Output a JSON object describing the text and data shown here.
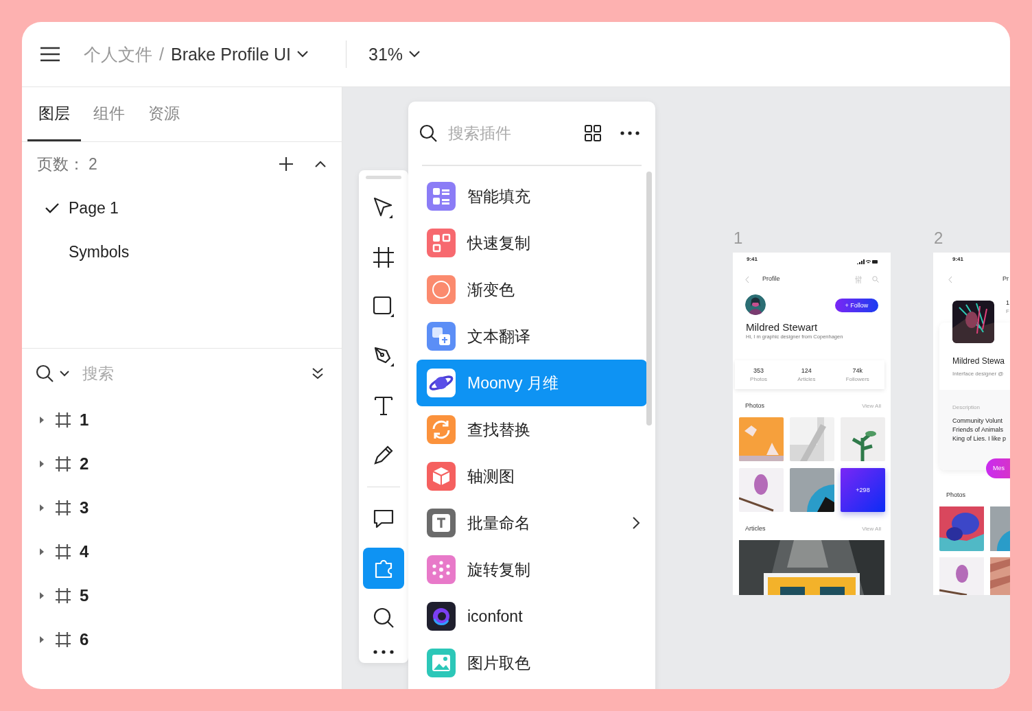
{
  "header": {
    "folder": "个人文件",
    "separator": "/",
    "file": "Brake Profile UI",
    "zoom": "31%"
  },
  "tabs": [
    {
      "label": "图层",
      "selected": true
    },
    {
      "label": "组件",
      "selected": false
    },
    {
      "label": "资源",
      "selected": false
    }
  ],
  "pages": {
    "label": "页数：",
    "count": "2",
    "items": [
      {
        "label": "Page 1",
        "selected": true
      },
      {
        "label": "Symbols",
        "selected": false
      }
    ]
  },
  "layer_search": {
    "placeholder": "搜索"
  },
  "layers": [
    {
      "label": "1",
      "expanded": false
    },
    {
      "label": "2",
      "expanded": false
    },
    {
      "label": "3",
      "expanded": false
    },
    {
      "label": "4",
      "expanded": false
    },
    {
      "label": "5",
      "expanded": false
    },
    {
      "label": "6",
      "expanded": false
    }
  ],
  "tools": [
    {
      "selected": false
    },
    {
      "selected": false
    },
    {
      "selected": false
    },
    {
      "selected": false
    },
    {
      "selected": false
    },
    {
      "selected": false
    }
  ],
  "tools_bottom": [
    {
      "selected": false
    },
    {
      "selected": true
    },
    {
      "selected": false
    }
  ],
  "plugin_search": {
    "placeholder": "搜索插件"
  },
  "plugins": [
    {
      "label": "智能填充",
      "color": "#8b7cf6",
      "selected": false,
      "submenu": false
    },
    {
      "label": "快速复制",
      "color": "#f7696f",
      "selected": false,
      "submenu": false
    },
    {
      "label": "渐变色",
      "color": "#fb8a6e",
      "selected": false,
      "submenu": false
    },
    {
      "label": "文本翻译",
      "color": "#5b8ef6",
      "selected": false,
      "submenu": false
    },
    {
      "label": "Moonvy 月维",
      "color": "#ffffff",
      "selected": true,
      "submenu": false
    },
    {
      "label": "查找替换",
      "color": "#fb923c",
      "selected": false,
      "submenu": false
    },
    {
      "label": "轴测图",
      "color": "#f5605f",
      "selected": false,
      "submenu": false
    },
    {
      "label": "批量命名",
      "color": "#6b6b6b",
      "selected": false,
      "submenu": true
    },
    {
      "label": "旋转复制",
      "color": "#e879c9",
      "selected": false,
      "submenu": false
    },
    {
      "label": "iconfont",
      "color": "#1f1f2e",
      "selected": false,
      "submenu": false
    },
    {
      "label": "图片取色",
      "color": "#2cc7b8",
      "selected": false,
      "submenu": false
    }
  ],
  "artboards": [
    {
      "label": "1",
      "time": "9:41",
      "title": "Profile",
      "follow": "+ Follow",
      "name": "Mildred Stewart",
      "bio": "Hi, I m graphic designer from Copenhagen",
      "stats": [
        {
          "value": "353",
          "label": "Photos"
        },
        {
          "value": "124",
          "label": "Articles"
        },
        {
          "value": "74k",
          "label": "Followers"
        }
      ],
      "photos_title": "Photos",
      "photos_link": "View All",
      "photos": [
        {
          "kind": "picture"
        },
        {
          "kind": "picture"
        },
        {
          "kind": "picture"
        },
        {
          "kind": "picture"
        },
        {
          "kind": "picture"
        },
        {
          "kind": "more",
          "label": "+298"
        }
      ],
      "articles_title": "Articles",
      "articles_link": "View All"
    },
    {
      "label": "2",
      "time": "9:41",
      "title": "Pr",
      "stat_value": "1",
      "stat_label": "F",
      "name": "Mildred Stewa",
      "role": "Interface designer @",
      "description_title": "Description",
      "description_lines": [
        "Community Volunt",
        "Friends of Animals",
        "King of Lies. I like p"
      ],
      "message": "Mes",
      "photos_title": "Photos"
    }
  ]
}
